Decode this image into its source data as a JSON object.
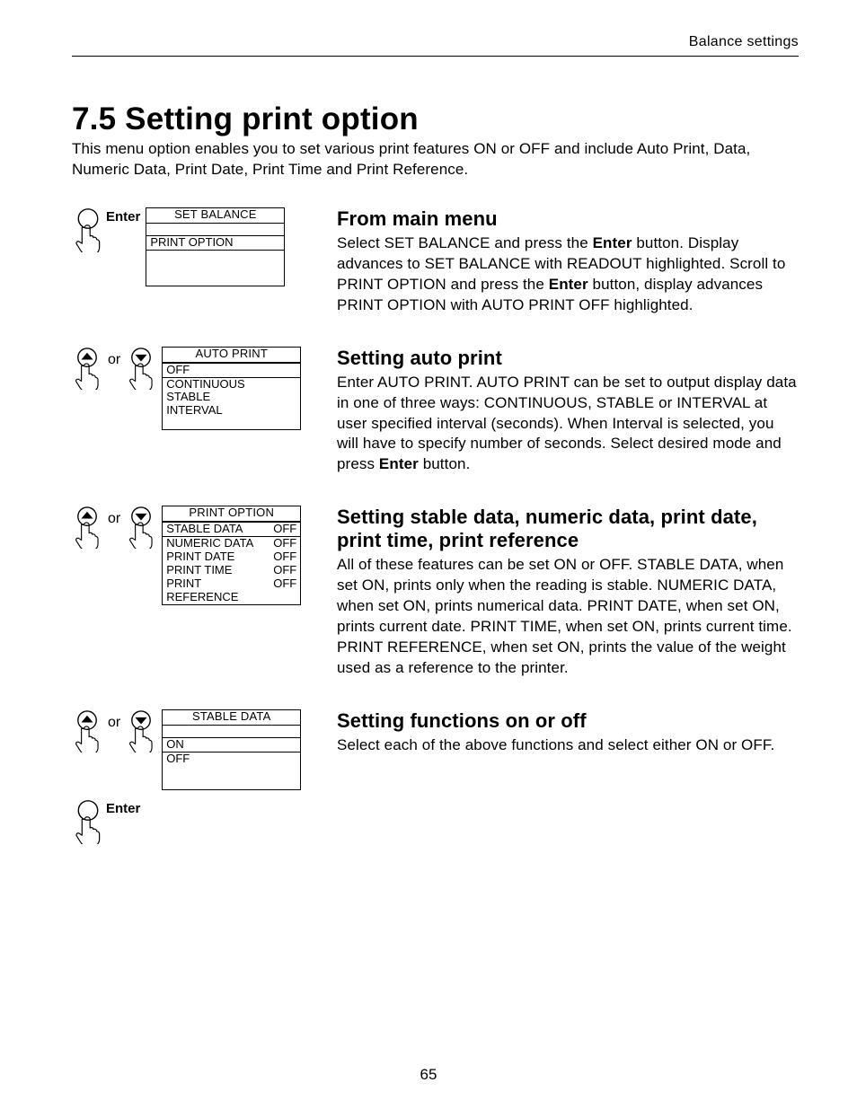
{
  "header": {
    "running": "Balance settings"
  },
  "title": "7.5  Setting print option",
  "intro": "This menu option enables you to set various print features ON or OFF and include Auto Print, Data, Numeric Data, Print Date, Print Time and Print Reference.",
  "sections": [
    {
      "heading": "From main menu",
      "body_pre": "Select SET BALANCE and press the ",
      "body_bold1": "Enter",
      "body_mid": " button.  Display advances to SET BALANCE with READOUT highlighted.  Scroll to PRINT OPTION and press the ",
      "body_bold2": "Enter",
      "body_post": " button, display advances PRINT OPTION with AUTO PRINT OFF highlighted.",
      "button_label": "Enter",
      "lcd": {
        "head": "SET BALANCE",
        "lines": [
          {
            "l": "",
            "r": "",
            "hl": false,
            "spacer": true
          },
          {
            "l": "PRINT OPTION",
            "r": "",
            "hl": true
          },
          {
            "l": "",
            "r": "",
            "spacer": true
          },
          {
            "l": "",
            "r": "",
            "spacer": true
          },
          {
            "l": "",
            "r": "",
            "spacer": true
          }
        ]
      }
    },
    {
      "heading": "Setting auto print",
      "body_pre": "Enter AUTO PRINT.  AUTO PRINT can be set to output display data in one of three ways:  CONTINUOUS, STABLE or INTERVAL at user specified interval (seconds).  When Interval is selected, you will have to specify number of seconds.  Select desired mode and press ",
      "body_bold1": "Enter",
      "body_post": " button.",
      "or_label": "or",
      "lcd": {
        "head": "AUTO PRINT",
        "lines": [
          {
            "l": "OFF",
            "r": "",
            "hl": true
          },
          {
            "l": "CONTINUOUS",
            "r": ""
          },
          {
            "l": "STABLE",
            "r": ""
          },
          {
            "l": "INTERVAL",
            "r": ""
          },
          {
            "l": "",
            "r": "",
            "spacer": true
          }
        ]
      }
    },
    {
      "heading": "Setting stable data, numeric data, print date, print time, print reference",
      "body_pre": "All of these features can be set ON or OFF.  STABLE DATA, when set ON, prints only when the reading is stable.  NUMERIC DATA, when set ON, prints numerical data.  PRINT DATE, when set ON, prints current date.  PRINT TIME, when set ON, prints current time.  PRINT REFERENCE, when set ON, prints the value of the weight used as a reference to the printer.",
      "or_label": "or",
      "lcd": {
        "head": "PRINT OPTION",
        "lines": [
          {
            "l": "STABLE DATA",
            "r": "OFF",
            "hl": true
          },
          {
            "l": "NUMERIC DATA",
            "r": "OFF"
          },
          {
            "l": "PRINT DATE",
            "r": "OFF"
          },
          {
            "l": "PRINT TIME",
            "r": "OFF"
          },
          {
            "l": "PRINT REFERENCE",
            "r": "OFF"
          }
        ]
      }
    },
    {
      "heading": "Setting functions on or off",
      "body_pre": "Select each of the above functions and select either ON or OFF.",
      "or_label": "or",
      "button_label": "Enter",
      "lcd": {
        "head": "STABLE DATA",
        "lines": [
          {
            "l": "",
            "r": "",
            "spacer": true
          },
          {
            "l": "ON",
            "r": "",
            "hl": true
          },
          {
            "l": "OFF",
            "r": ""
          },
          {
            "l": "",
            "r": "",
            "spacer": true
          },
          {
            "l": "",
            "r": "",
            "spacer": true
          }
        ]
      }
    }
  ],
  "page_number": "65"
}
